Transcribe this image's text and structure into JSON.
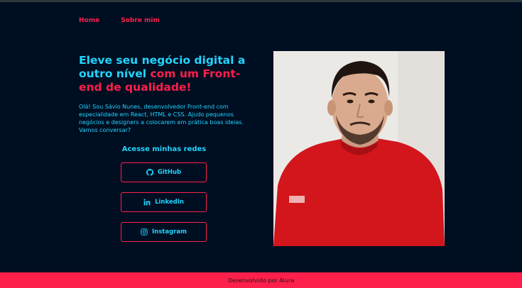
{
  "nav": {
    "home": "Home",
    "about": "Sobre mim"
  },
  "hero": {
    "headline_part1": "Eleve seu negócio digital a outro nível ",
    "headline_part2": "com um Front-end de qualidade!",
    "intro": "Olá! Sou Sávio Nunes, desenvolvedor Front-end com especialidade em React, HTML e CSS. Ajudo pequenos negócios e designers a colocarem em prática boas ideias. Vamos conversar?"
  },
  "social": {
    "title": "Acesse minhas redes",
    "github": "GitHub",
    "linkedin": "LinkedIn",
    "instagram": "Instagram"
  },
  "icons": {
    "github": "github-icon",
    "linkedin": "linkedin-icon",
    "instagram": "instagram-icon"
  },
  "colors": {
    "background": "#000e22",
    "primary": "#22d4fd",
    "accent": "#ff1f4b"
  },
  "footer": {
    "text": "Desenvolvido por Alura"
  }
}
